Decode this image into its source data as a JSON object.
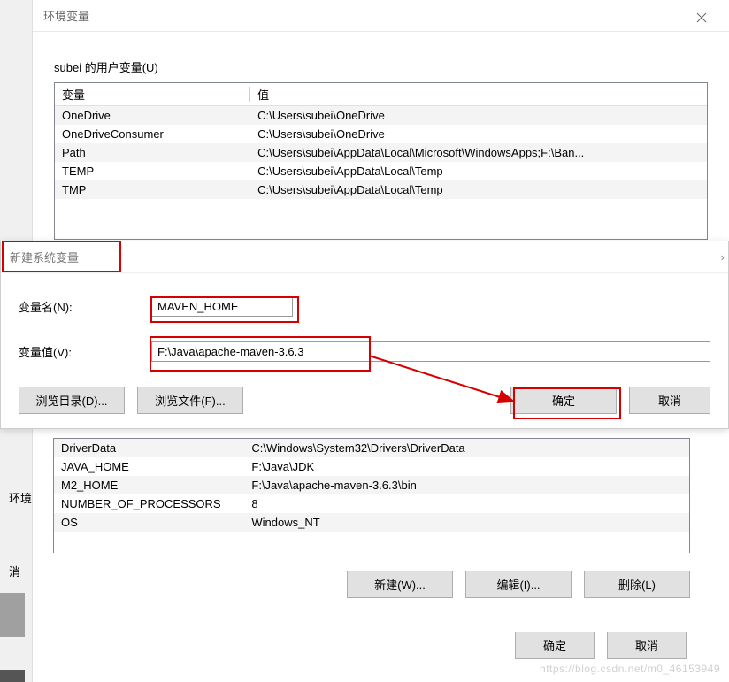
{
  "env_window": {
    "title": "环境变量",
    "close_icon": "×",
    "user_section_label": "subei 的用户变量(U)",
    "table_headers": {
      "var": "变量",
      "val": "值"
    },
    "user_vars": [
      {
        "name": "OneDrive",
        "value": "C:\\Users\\subei\\OneDrive"
      },
      {
        "name": "OneDriveConsumer",
        "value": "C:\\Users\\subei\\OneDrive"
      },
      {
        "name": "Path",
        "value": "C:\\Users\\subei\\AppData\\Local\\Microsoft\\WindowsApps;F:\\Ban..."
      },
      {
        "name": "TEMP",
        "value": "C:\\Users\\subei\\AppData\\Local\\Temp"
      },
      {
        "name": "TMP",
        "value": "C:\\Users\\subei\\AppData\\Local\\Temp"
      }
    ],
    "sys_vars": [
      {
        "name": "DriverData",
        "value": "C:\\Windows\\System32\\Drivers\\DriverData"
      },
      {
        "name": "JAVA_HOME",
        "value": "F:\\Java\\JDK"
      },
      {
        "name": "M2_HOME",
        "value": "F:\\Java\\apache-maven-3.6.3\\bin"
      },
      {
        "name": "NUMBER_OF_PROCESSORS",
        "value": "8"
      },
      {
        "name": "OS",
        "value": "Windows_NT"
      }
    ],
    "buttons": {
      "new": "新建(W)...",
      "edit": "编辑(I)...",
      "delete": "删除(L)",
      "ok": "确定",
      "cancel": "取消"
    }
  },
  "subdialog": {
    "title": "新建系统变量",
    "name_label": "变量名(N):",
    "name_value": "MAVEN_HOME",
    "value_label": "变量值(V):",
    "value_value": "F:\\Java\\apache-maven-3.6.3",
    "browse_dir": "浏览目录(D)...",
    "browse_file": "浏览文件(F)...",
    "ok": "确定",
    "cancel": "取消"
  },
  "left_fragments": {
    "label": "环境",
    "msg": "消"
  },
  "watermark": "https://blog.csdn.net/m0_46153949"
}
